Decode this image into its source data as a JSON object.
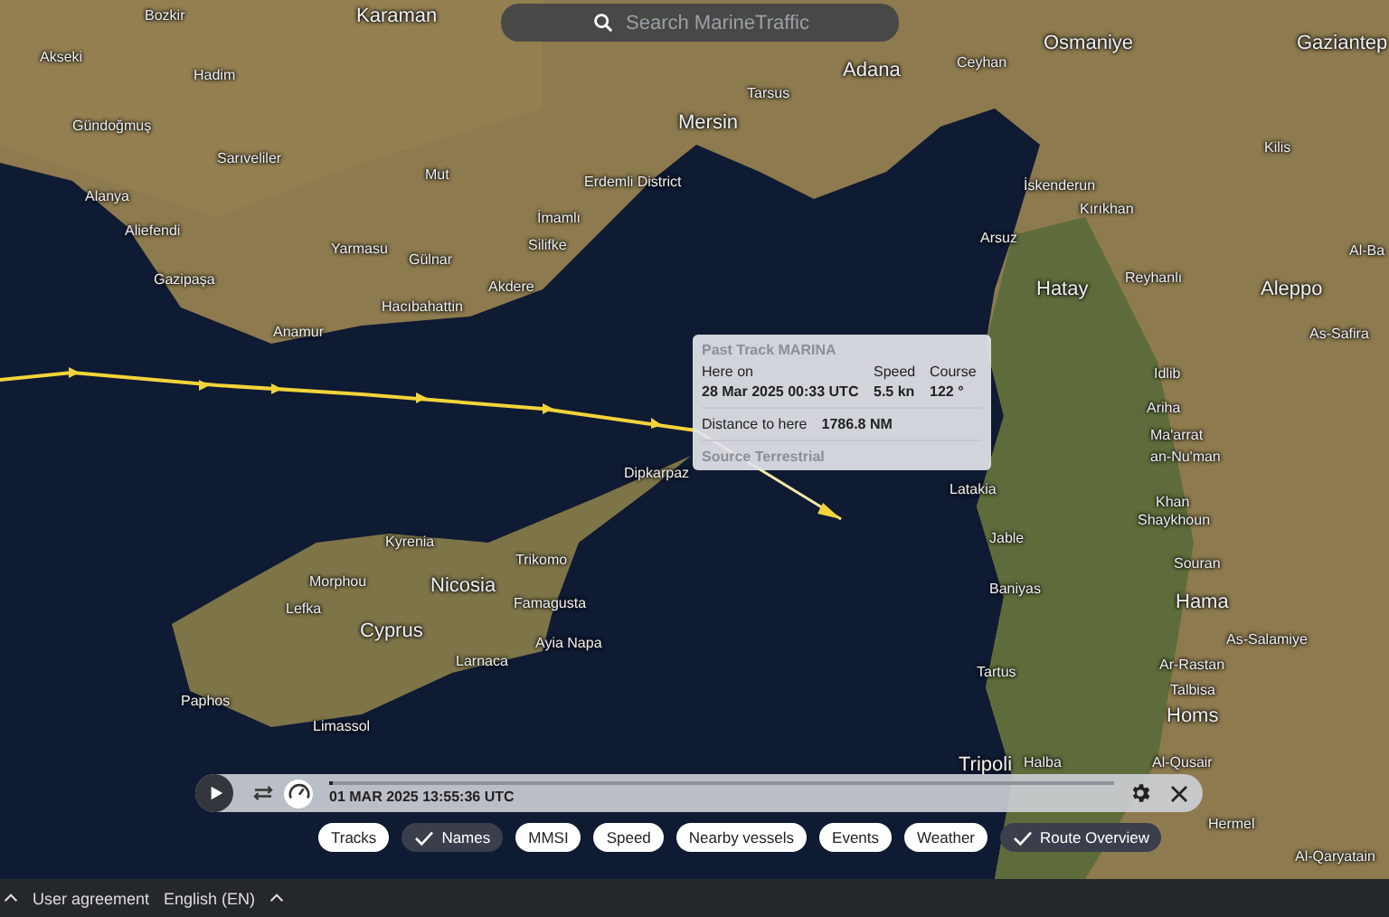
{
  "search": {
    "placeholder": "Search MarineTraffic"
  },
  "map_labels": [
    {
      "text": "Bozkir",
      "kind": "minor"
    },
    {
      "text": "Karaman",
      "kind": "major"
    },
    {
      "text": "Akseki",
      "kind": "minor"
    },
    {
      "text": "Hadim",
      "kind": "minor"
    },
    {
      "text": "Gündoğmuş",
      "kind": "minor"
    },
    {
      "text": "Sarıveliler",
      "kind": "minor"
    },
    {
      "text": "Mut",
      "kind": "minor"
    },
    {
      "text": "Erdemli District",
      "kind": "minor"
    },
    {
      "text": "Mersin",
      "kind": "major"
    },
    {
      "text": "Alanya",
      "kind": "minor"
    },
    {
      "text": "Aliefendi",
      "kind": "minor"
    },
    {
      "text": "İmamlı",
      "kind": "minor"
    },
    {
      "text": "Yarmasu",
      "kind": "minor"
    },
    {
      "text": "Gülnar",
      "kind": "minor"
    },
    {
      "text": "Silifke",
      "kind": "minor"
    },
    {
      "text": "Gazipaşa",
      "kind": "minor"
    },
    {
      "text": "Akdere",
      "kind": "minor"
    },
    {
      "text": "Hacıbahattin",
      "kind": "minor"
    },
    {
      "text": "Anamur",
      "kind": "minor"
    },
    {
      "text": "Adana",
      "kind": "major"
    },
    {
      "text": "Tarsus",
      "kind": "minor"
    },
    {
      "text": "Ceyhan",
      "kind": "minor"
    },
    {
      "text": "Osmaniye",
      "kind": "major"
    },
    {
      "text": "Gaziantep",
      "kind": "major"
    },
    {
      "text": "Kilis",
      "kind": "minor"
    },
    {
      "text": "İskenderun",
      "kind": "minor"
    },
    {
      "text": "Kırıkhan",
      "kind": "minor"
    },
    {
      "text": "Arsuz",
      "kind": "minor"
    },
    {
      "text": "Al-Ba",
      "kind": "minor"
    },
    {
      "text": "Reyhanlı",
      "kind": "minor"
    },
    {
      "text": "Hatay",
      "kind": "major"
    },
    {
      "text": "Aleppo",
      "kind": "major"
    },
    {
      "text": "As-Safira",
      "kind": "minor"
    },
    {
      "text": "Idlib",
      "kind": "minor"
    },
    {
      "text": "Ariha",
      "kind": "minor"
    },
    {
      "text": "Ma'arrat",
      "kind": "minor"
    },
    {
      "text": "an-Nu'man",
      "kind": "minor"
    },
    {
      "text": "Dipkarpaz",
      "kind": "minor"
    },
    {
      "text": "Kyrenia",
      "kind": "minor"
    },
    {
      "text": "Trikomo",
      "kind": "minor"
    },
    {
      "text": "Morphou",
      "kind": "minor"
    },
    {
      "text": "Nicosia",
      "kind": "major"
    },
    {
      "text": "Lefka",
      "kind": "minor"
    },
    {
      "text": "Famagusta",
      "kind": "minor"
    },
    {
      "text": "Cyprus",
      "kind": "major"
    },
    {
      "text": "Ayia Napa",
      "kind": "minor"
    },
    {
      "text": "Larnaca",
      "kind": "minor"
    },
    {
      "text": "Paphos",
      "kind": "minor"
    },
    {
      "text": "Limassol",
      "kind": "minor"
    },
    {
      "text": "Latakia",
      "kind": "minor"
    },
    {
      "text": "Khan",
      "kind": "minor"
    },
    {
      "text": "Shaykhoun",
      "kind": "minor"
    },
    {
      "text": "Jable",
      "kind": "minor"
    },
    {
      "text": "Souran",
      "kind": "minor"
    },
    {
      "text": "Baniyas",
      "kind": "minor"
    },
    {
      "text": "Hama",
      "kind": "major"
    },
    {
      "text": "As-Salamiye",
      "kind": "minor"
    },
    {
      "text": "Tartus",
      "kind": "minor"
    },
    {
      "text": "Ar-Rastan",
      "kind": "minor"
    },
    {
      "text": "Talbisa",
      "kind": "minor"
    },
    {
      "text": "Homs",
      "kind": "major"
    },
    {
      "text": "Tripoli",
      "kind": "major"
    },
    {
      "text": "Halba",
      "kind": "minor"
    },
    {
      "text": "Al-Qusair",
      "kind": "minor"
    },
    {
      "text": "Hermel",
      "kind": "minor"
    },
    {
      "text": "Al-Qaryatain",
      "kind": "minor"
    }
  ],
  "popup": {
    "title": "Past Track MARINA",
    "here_on_label": "Here on",
    "speed_label": "Speed",
    "course_label": "Course",
    "date": "28 Mar 2025 00:33 UTC",
    "speed": "5.5 kn",
    "course": "122 °",
    "distance_label": "Distance to here",
    "distance": "1786.8 NM",
    "source": "Source Terrestrial"
  },
  "playback": {
    "timestamp": "01 MAR 2025 13:55:36 UTC",
    "level": 0.005
  },
  "filters": [
    {
      "label": "Tracks",
      "selected": false
    },
    {
      "label": "Names",
      "selected": true
    },
    {
      "label": "MMSI",
      "selected": false
    },
    {
      "label": "Speed",
      "selected": false
    },
    {
      "label": "Nearby vessels",
      "selected": false
    },
    {
      "label": "Events",
      "selected": false
    },
    {
      "label": "Weather",
      "selected": false
    },
    {
      "label": "Route Overview",
      "selected": true
    }
  ],
  "footer": {
    "links": [
      "User agreement",
      "English (EN)"
    ]
  }
}
